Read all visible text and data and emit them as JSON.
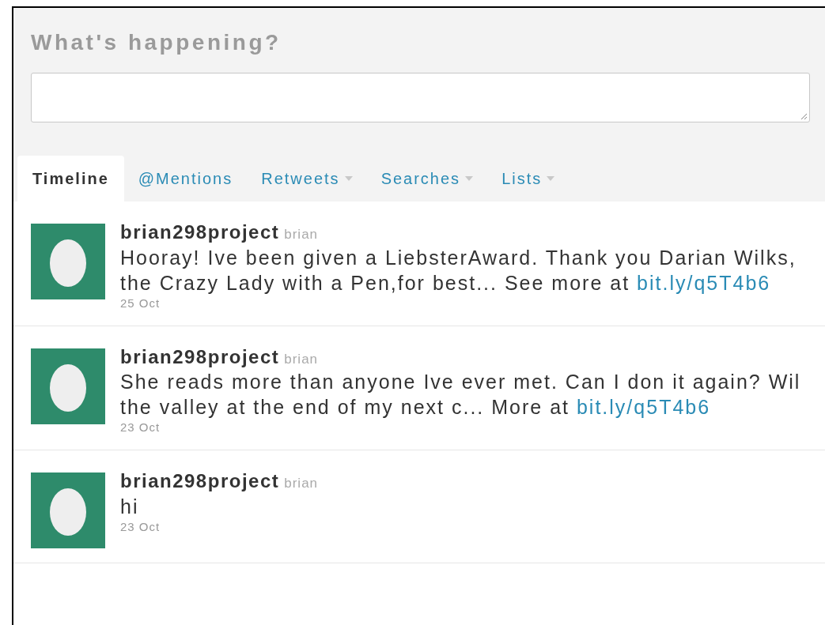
{
  "composer": {
    "heading": "What's happening?"
  },
  "tabs": [
    {
      "label": "Timeline",
      "selected": true,
      "dropdown": false
    },
    {
      "label": "@Mentions",
      "selected": false,
      "dropdown": false
    },
    {
      "label": "Retweets",
      "selected": false,
      "dropdown": true
    },
    {
      "label": "Searches",
      "selected": false,
      "dropdown": true
    },
    {
      "label": "Lists",
      "selected": false,
      "dropdown": true
    }
  ],
  "tweets": [
    {
      "username": "brian298project",
      "name": "brian",
      "text": "Hooray! Ive been given a LiebsterAward. Thank you Darian Wilks, the Crazy Lady with a Pen,for best... See more at",
      "link": "bit.ly/q5T4b6",
      "date": "25 Oct"
    },
    {
      "username": "brian298project",
      "name": "brian",
      "text": "She reads more than anyone Ive ever met. Can I don it again? Wil the valley at the end of my next c... More at",
      "link": "bit.ly/q5T4b6",
      "date": "23 Oct"
    },
    {
      "username": "brian298project",
      "name": "brian",
      "text": "hi",
      "date": "23 Oct"
    }
  ]
}
